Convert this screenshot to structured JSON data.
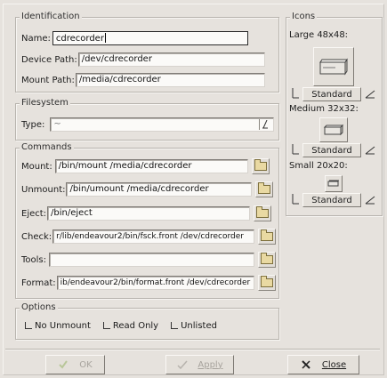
{
  "identification": {
    "legend": "Identification",
    "name_label": "Name:",
    "name_value": "cdrecorder",
    "device_path_label": "Device Path:",
    "device_path_value": "/dev/cdrecorder",
    "mount_path_label": "Mount Path:",
    "mount_path_value": "/media/cdrecorder"
  },
  "filesystem": {
    "legend": "Filesystem",
    "type_label": "Type:",
    "type_value": "~"
  },
  "commands": {
    "legend": "Commands",
    "items": [
      {
        "label": "Mount:",
        "value": "/bin/mount /media/cdrecorder"
      },
      {
        "label": "Unmount:",
        "value": "/bin/umount /media/cdrecorder"
      },
      {
        "label": "Eject:",
        "value": "/bin/eject"
      },
      {
        "label": "Check:",
        "value": "r/lib/endeavour2/bin/fsck.front /dev/cdrecorder"
      },
      {
        "label": "Tools:",
        "value": ""
      },
      {
        "label": "Format:",
        "value": "ib/endeavour2/bin/format.front /dev/cdrecorder"
      }
    ]
  },
  "options": {
    "legend": "Options",
    "no_unmount": "No Unmount",
    "read_only": "Read Only",
    "unlisted": "Unlisted"
  },
  "icons": {
    "legend": "Icons",
    "large_label": "Large 48x48:",
    "medium_label": "Medium 32x32:",
    "small_label": "Small 20x20:",
    "standard_label": "Standard"
  },
  "buttons": {
    "ok": "OK",
    "apply": "Apply",
    "close": "Close"
  }
}
